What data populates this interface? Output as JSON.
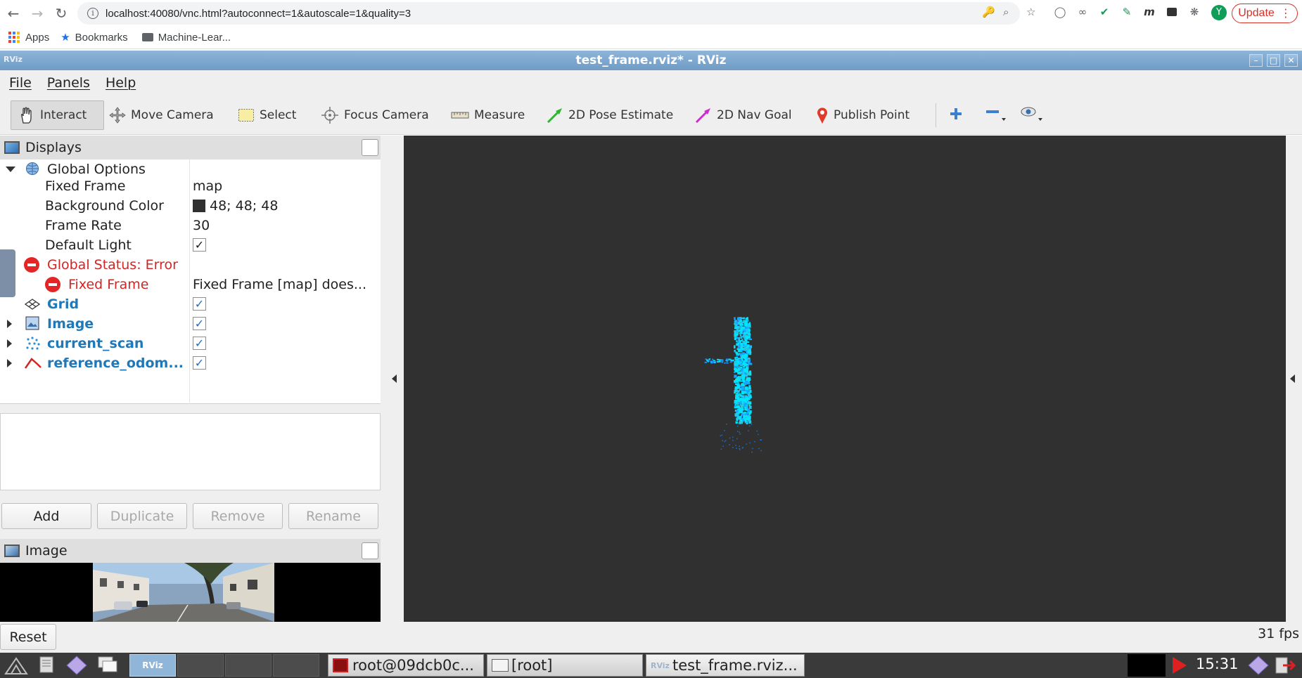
{
  "browser": {
    "url": "localhost:40080/vnc.html?autoconnect=1&autoscale=1&quality=3",
    "update_label": "Update",
    "avatar_letter": "Y",
    "bookmarks": [
      {
        "label": "Apps"
      },
      {
        "label": "Bookmarks"
      },
      {
        "label": "Machine-Lear..."
      }
    ]
  },
  "window": {
    "title": "test_frame.rviz* - RViz",
    "logo": "RViz"
  },
  "menu": [
    "File",
    "Panels",
    "Help"
  ],
  "toolbar": {
    "tools": [
      {
        "label": "Interact",
        "icon": "hand-icon"
      },
      {
        "label": "Move Camera",
        "icon": "move-camera-icon"
      },
      {
        "label": "Select",
        "icon": "select-icon"
      },
      {
        "label": "Focus Camera",
        "icon": "focus-camera-icon"
      },
      {
        "label": "Measure",
        "icon": "ruler-icon"
      },
      {
        "label": "2D Pose Estimate",
        "icon": "pose-arrow-icon"
      },
      {
        "label": "2D Nav Goal",
        "icon": "nav-goal-arrow-icon"
      },
      {
        "label": "Publish Point",
        "icon": "map-pin-icon"
      }
    ]
  },
  "displays": {
    "header": "Displays",
    "global_options": "Global Options",
    "properties": [
      {
        "key": "Fixed Frame",
        "value": "map"
      },
      {
        "key": "Background Color",
        "value": "48; 48; 48"
      },
      {
        "key": "Frame Rate",
        "value": "30"
      },
      {
        "key": "Default Light",
        "value": "✓"
      }
    ],
    "status_label": "Global Status: Error",
    "status_child_key": "Fixed Frame",
    "status_child_value": "Fixed Frame [map] does...",
    "items": [
      {
        "label": "Grid",
        "checked": "✓"
      },
      {
        "label": "Image",
        "checked": "✓"
      },
      {
        "label": "current_scan",
        "checked": "✓"
      },
      {
        "label": "reference_odom...",
        "checked": "✓"
      }
    ],
    "buttons": [
      "Add",
      "Duplicate",
      "Remove",
      "Rename"
    ],
    "background_color_hex": "#303030"
  },
  "image_panel": {
    "header": "Image"
  },
  "status": {
    "reset_label": "Reset",
    "fps": "31 fps"
  },
  "taskbar": {
    "tasks": [
      {
        "label": "root@09dcb0c..."
      },
      {
        "label": "[root]"
      },
      {
        "label": "test_frame.rviz..."
      }
    ],
    "clock": "15:31"
  },
  "colors": {
    "accent": "#1f78b8",
    "error": "#d42424",
    "point_cloud": "#00e5ff"
  }
}
